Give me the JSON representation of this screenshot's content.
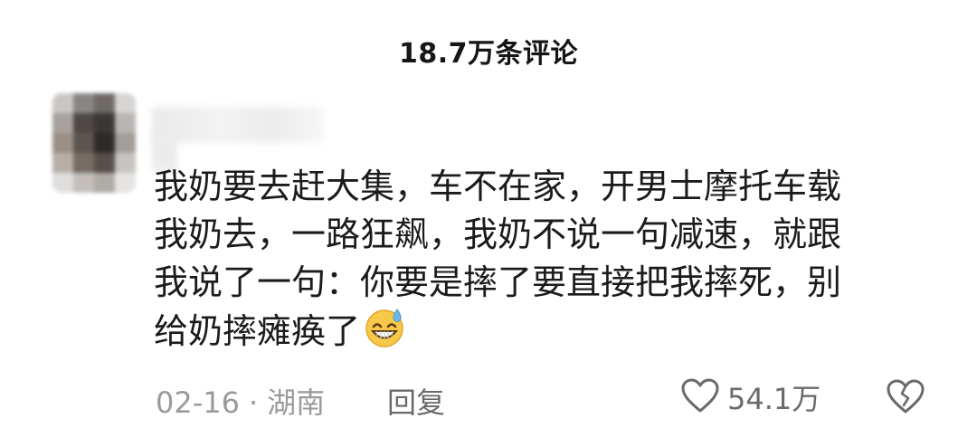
{
  "header": {
    "title": "18.7万条评论"
  },
  "comment": {
    "lines": [
      "我奶要去赶大集，车不在家，开男士摩托车载",
      "我奶去，一路狂飙，我奶不说一句减速，就跟",
      "我说了一句：你要是摔了要直接把我摔死，别",
      "给奶摔瘫痪了"
    ],
    "emoji": "grinning-sweat-emoji",
    "date": "02-16",
    "separator": "·",
    "location": "湖南",
    "reply_label": "回复",
    "like_count": "54.1万"
  },
  "icons": {
    "like": "heart-outline-icon",
    "dislike": "broken-heart-icon"
  },
  "colors": {
    "text": "#1b1b1b",
    "meta": "#9a9a9a",
    "action": "#6a6a6a",
    "emoji_face": "#f7c84a",
    "emoji_sweat": "#6fb7e8"
  }
}
